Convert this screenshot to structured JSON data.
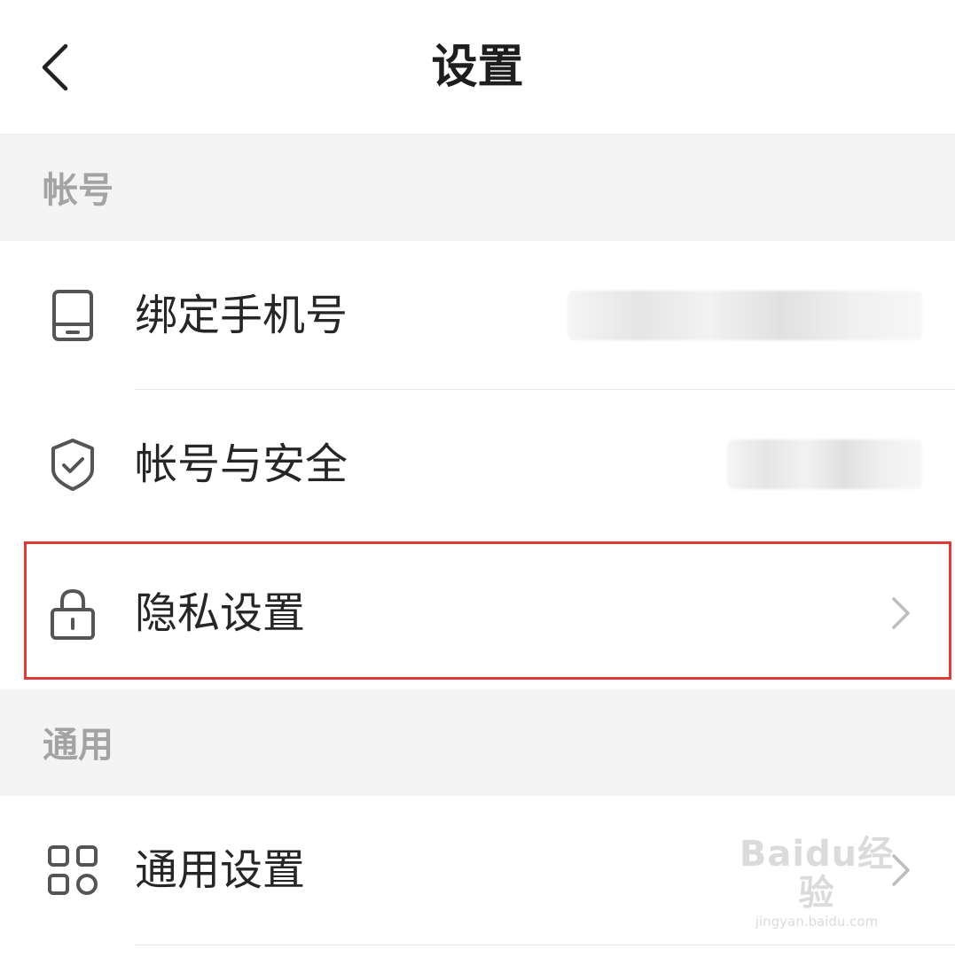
{
  "header": {
    "title": "设置"
  },
  "sections": [
    {
      "title": "帐号"
    },
    {
      "title": "通用"
    }
  ],
  "rows": [
    {
      "label": "绑定手机号",
      "icon": "phone-icon",
      "value_redacted": true
    },
    {
      "label": "帐号与安全",
      "icon": "shield-check-icon",
      "value_redacted": true
    },
    {
      "label": "隐私设置",
      "icon": "lock-icon",
      "highlighted": true
    },
    {
      "label": "通用设置",
      "icon": "grid-icon"
    }
  ],
  "highlight_color": "#e03a36",
  "watermark": {
    "brand": "Baidu经验",
    "url": "jingyan.baidu.com"
  }
}
